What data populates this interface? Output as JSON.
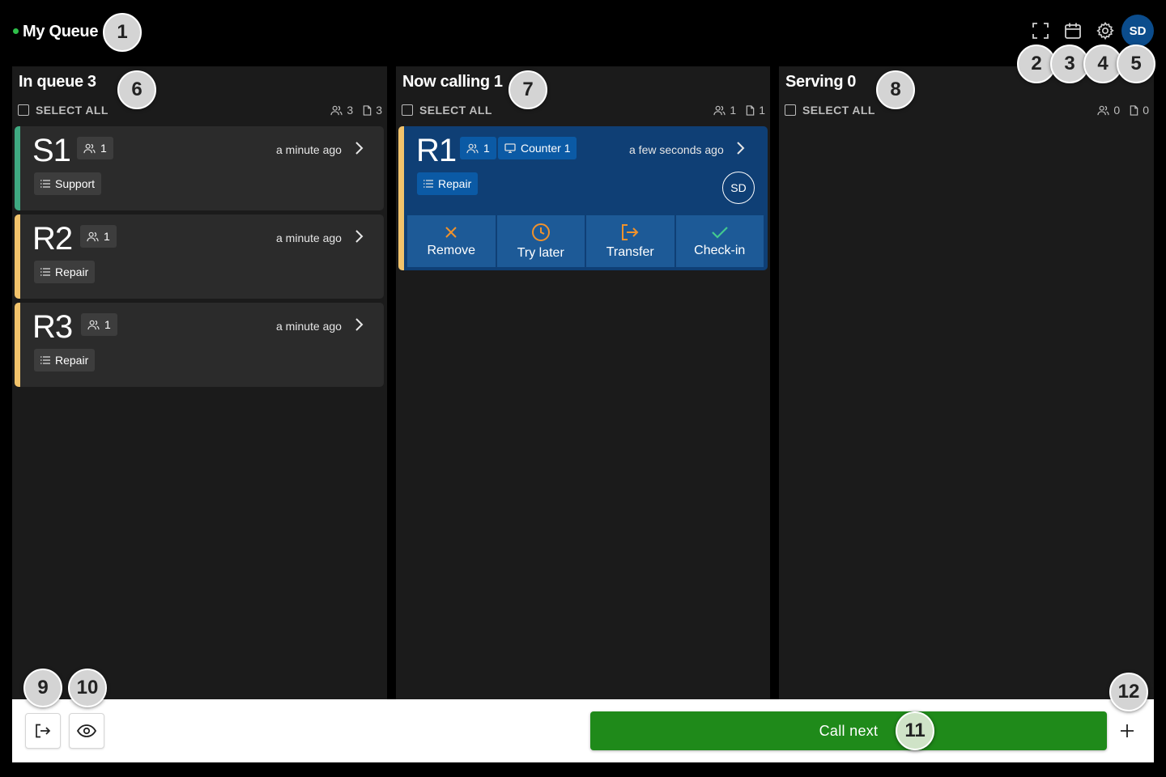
{
  "header": {
    "title": "My Queue",
    "status_color": "#2fbf4a",
    "icons": [
      "fullscreen-icon",
      "calendar-icon",
      "settings-icon"
    ],
    "user_initials": "SD"
  },
  "columns": [
    {
      "title": "In queue",
      "count": "3",
      "select_all": "SELECT ALL",
      "people": "3",
      "tickets": "3",
      "cards": [
        {
          "number": "S1",
          "party": "1",
          "time": "a minute ago",
          "service": "Support",
          "accent": "#3fa981"
        },
        {
          "number": "R2",
          "party": "1",
          "time": "a minute ago",
          "service": "Repair",
          "accent": "#f2c36b"
        },
        {
          "number": "R3",
          "party": "1",
          "time": "a minute ago",
          "service": "Repair",
          "accent": "#f2c36b"
        }
      ]
    },
    {
      "title": "Now calling",
      "count": "1",
      "select_all": "SELECT ALL",
      "people": "1",
      "tickets": "1",
      "cards": [
        {
          "number": "R1",
          "party": "1",
          "counter": "Counter 1",
          "time": "a few seconds ago",
          "service": "Repair",
          "assignee": "SD",
          "accent": "#f2c36b",
          "actions": [
            {
              "label": "Remove",
              "icon": "close-icon"
            },
            {
              "label": "Try later",
              "icon": "clock-icon"
            },
            {
              "label": "Transfer",
              "icon": "transfer-icon"
            },
            {
              "label": "Check-in",
              "icon": "check-icon"
            }
          ]
        }
      ]
    },
    {
      "title": "Serving",
      "count": "0",
      "select_all": "SELECT ALL",
      "people": "0",
      "tickets": "0",
      "cards": []
    }
  ],
  "footer": {
    "call_next": "Call next",
    "icons": [
      "logout-icon",
      "eye-icon",
      "plus-icon"
    ],
    "accent": "#1f8a1a"
  },
  "callouts": [
    "1",
    "2",
    "3",
    "4",
    "5",
    "6",
    "7",
    "8",
    "9",
    "10",
    "11",
    "12"
  ]
}
